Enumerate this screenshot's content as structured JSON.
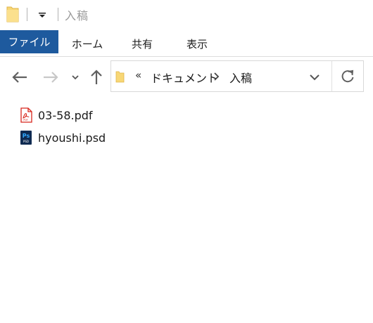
{
  "titlebar": {
    "title": "入稿",
    "folder_icon": "folder-icon",
    "quick_access_icon": "customize-quick-access-icon"
  },
  "ribbon": {
    "tabs": [
      {
        "label": "ファイル",
        "active": true
      },
      {
        "label": "ホーム"
      },
      {
        "label": "共有"
      },
      {
        "label": "表示"
      }
    ]
  },
  "nav": {
    "back_icon": "back-arrow-icon",
    "forward_icon": "forward-arrow-icon",
    "recent_icon": "chevron-down-icon",
    "up_icon": "up-arrow-icon"
  },
  "address": {
    "overflow": "«",
    "crumbs": [
      "ドキュメント",
      "入稿"
    ],
    "separator_icon": "chevron-right-icon",
    "dropdown_icon": "chevron-down-icon",
    "refresh_icon": "refresh-icon"
  },
  "files": [
    {
      "name": "03-58.pdf",
      "icon": "pdf-file-icon"
    },
    {
      "name": "hyoushi.psd",
      "icon": "photoshop-file-icon"
    }
  ],
  "colors": {
    "file_tab_bg": "#1e5a9e",
    "folder_yellow": "#f8d775",
    "pdf_red": "#d8261c",
    "psd_blue": "#0f2b52",
    "psd_text": "#31a8ff"
  }
}
